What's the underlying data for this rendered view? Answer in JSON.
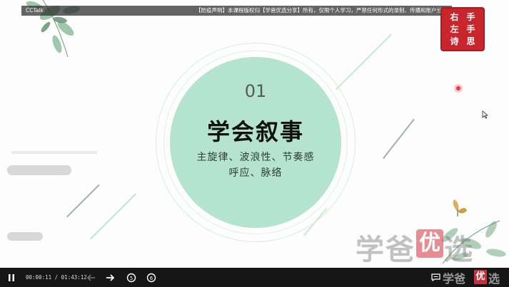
{
  "player": {
    "title_label": "CCTalk",
    "notice": "【防疫声明】本课程版权归【学爸优选分享】所有，仅限个人学习，严禁任何形式的录制、传播和账户分享。"
  },
  "seal": {
    "chars": [
      "右",
      "手",
      "左",
      "手",
      "诗",
      "思"
    ]
  },
  "slide": {
    "number": "01",
    "title": "学会叙事",
    "subtitle_line1": "主旋律、波浪性、节奏感",
    "subtitle_line2": "呼应、脉络"
  },
  "watermark": {
    "text": "学爸",
    "highlight": "优",
    "tail": "选"
  },
  "controls": {
    "time": "00:00:11 / 01:43:12",
    "speed_back": "5",
    "speed_fwd": "6",
    "wm_text": "学爸",
    "wm_highlight": "优",
    "wm_tail": "选"
  },
  "colors": {
    "circle": "#b4e4d0",
    "accent_red": "#c8252c",
    "leaf_green": "#7fae8e"
  },
  "icons": [
    "pause-icon",
    "arrow-left-icon",
    "arrow-right-icon",
    "rewind-5-icon",
    "forward-6-icon",
    "danmaku-icon",
    "leaf-icon",
    "butterfly-icon",
    "cursor-icon"
  ]
}
